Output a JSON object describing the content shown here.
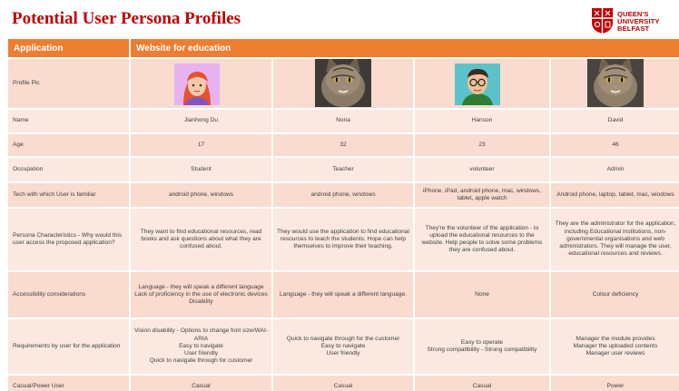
{
  "title": "Potential User Persona Profiles",
  "logo": {
    "line1": "QUEEN'S",
    "line2": "UNIVERSITY",
    "line3": "BELFAST",
    "color": "#c00000"
  },
  "header": {
    "col1": "Application",
    "col2": "Website for education",
    "color": "#ed7d31"
  },
  "row_labels": {
    "profile_pic": "Profile Pic",
    "name": "Name",
    "age": "Age",
    "occupation": "Occupation",
    "tech": "Tech with which User is familiar",
    "characteristics": "Persona Characteristics - Why would this user access the proposed application?",
    "accessibility": "Accessibility considerations",
    "requirements": "Requirements by user for  the application",
    "casual_power": "Casual/Power User"
  },
  "personas": [
    {
      "avatar": "cartoon-woman-red-hair",
      "name": "Jianhong Du",
      "age": "17",
      "occupation": "Student",
      "tech": "android phone, windows",
      "characteristics": "They want to find educational resources, read books and ask questions about what they are confused about.",
      "accessibility": "Language - they will speak a different language\nLack of proficiency in the use of electronic devices\nDisability",
      "requirements": "Vision disability - Options to change font size/WAI-ARIA\nEasy to navigate\nUser friendly\nQuick to navigate through for customer",
      "casual_power": "Casual"
    },
    {
      "avatar": "cat-photo",
      "name": "Noria",
      "age": "32",
      "occupation": "Teacher",
      "tech": "android phone, windows",
      "characteristics": "They would use the application to find educational resources to teach the students. Hope can help themselves to improve their teaching.",
      "accessibility": "Language - they will speak a different language.",
      "requirements": "Quick to navigate through for the customer\nEasy to navigate\nUser friendly",
      "casual_power": "Casual"
    },
    {
      "avatar": "cartoon-man-glasses",
      "name": "Hanson",
      "age": "23",
      "occupation": "volunteer",
      "tech": "iPhone, iPad, android phone, mac, windows, tablet, apple watch",
      "characteristics": "They're the volunteer of the application - to upload the educational resources to the website. Help people to solve some problems they are confused about.",
      "accessibility": "None",
      "requirements": "Easy to operate\nStrong compatibility - Strong compatibility",
      "casual_power": "Casual"
    },
    {
      "avatar": "cat-photo",
      "name": "David",
      "age": "46",
      "occupation": "Admin",
      "tech": "Android phone, laptop, tablet, mac, windows",
      "characteristics": "They are the administrator for the application, including Educational institutions, non-governmental organisations and web administrators. They will manage the user, educational resources and reviews.",
      "accessibility": "Colour deficiency",
      "requirements": "Manager the module provides\nManager the uploaded contents\nManager user reviews",
      "casual_power": "Power"
    }
  ]
}
